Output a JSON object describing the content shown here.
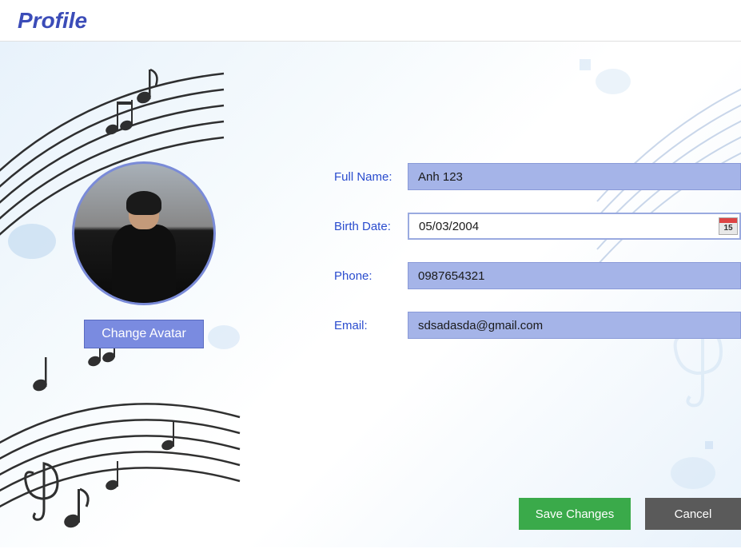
{
  "header": {
    "title": "Profile"
  },
  "avatar": {
    "change_button_label": "Change Avatar"
  },
  "form": {
    "full_name": {
      "label": "Full Name:",
      "value": "Anh 123"
    },
    "birth_date": {
      "label": "Birth Date:",
      "value": "05/03/2004",
      "icon_day": "15"
    },
    "phone": {
      "label": "Phone:",
      "value": "0987654321"
    },
    "email": {
      "label": "Email:",
      "value": "sdsadasda@gmail.com"
    }
  },
  "buttons": {
    "save": "Save Changes",
    "cancel": "Cancel"
  }
}
